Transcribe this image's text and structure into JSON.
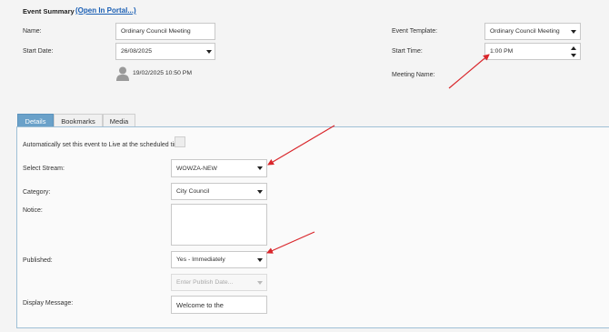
{
  "header": {
    "section_title": "Event Summary",
    "portal_link": "(Open In Portal...)"
  },
  "summary": {
    "name_label": "Name:",
    "name_value": "Ordinary Council Meeting",
    "start_date_label": "Start Date:",
    "start_date_value": "26/08/2025",
    "created_stamp": "19/02/2025 10:50 PM",
    "event_template_label": "Event Template:",
    "event_template_value": "Ordinary Council Meeting",
    "start_time_label": "Start Time:",
    "start_time_value": "1:00 PM",
    "meeting_name_label": "Meeting Name:"
  },
  "tabs": [
    {
      "label": "Details",
      "active": true
    },
    {
      "label": "Bookmarks",
      "active": false
    },
    {
      "label": "Media",
      "active": false
    }
  ],
  "details": {
    "auto_live_label": "Automatically set this event to Live at the scheduled time",
    "auto_live_checked": false,
    "stream_label": "Select Stream:",
    "stream_value": "WOWZA-NEW",
    "category_label": "Category:",
    "category_value": "City Council",
    "notice_label": "Notice:",
    "notice_value": "",
    "published_label": "Published:",
    "published_value": "Yes - Immediately",
    "publish_date_placeholder": "Enter Publish Date...",
    "display_message_label": "Display Message:",
    "display_message_value": "Welcome to the"
  },
  "colors": {
    "link": "#1a5fb4",
    "active_tab": "#6aa1c9",
    "annotation_arrow": "#d9262b"
  }
}
